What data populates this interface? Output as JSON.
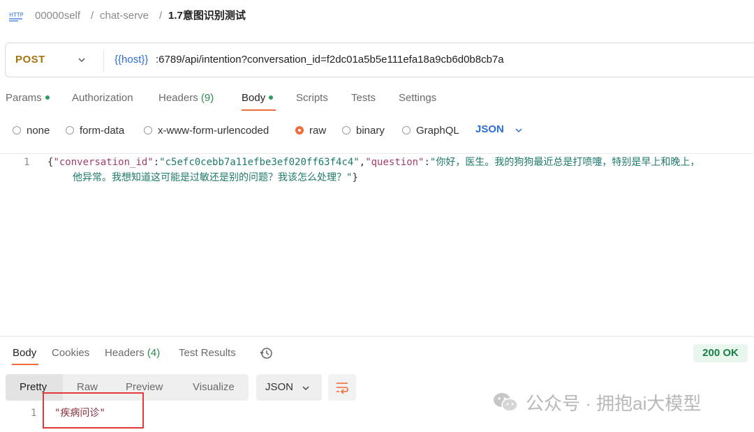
{
  "breadcrumb": {
    "icon_text": "HTTP",
    "workspace": "00000self",
    "collection": "chat-serve",
    "request": "1.7意图识别测试",
    "separator": "/"
  },
  "request": {
    "method": "POST",
    "url_variable": "{{host}}",
    "url_rest": ":6789/api/intention?conversation_id=f2dc01a5b5e111efa18a9cb6d0b8cb7a"
  },
  "request_tabs": {
    "params": "Params",
    "authorization": "Authorization",
    "headers": "Headers",
    "headers_count": "(9)",
    "body": "Body",
    "scripts": "Scripts",
    "tests": "Tests",
    "settings": "Settings"
  },
  "body_types": {
    "none": "none",
    "form_data": "form-data",
    "urlencoded": "x-www-form-urlencoded",
    "raw": "raw",
    "binary": "binary",
    "graphql": "GraphQL",
    "selected": "raw",
    "format": "JSON"
  },
  "editor": {
    "line_number": "1",
    "open_brace": "{",
    "key1": "\"conversation_id\"",
    "colon1": ":",
    "val1": "\"c5efc0cebb7a11efbe3ef020ff63f4c4\"",
    "comma": ",",
    "key2": "\"question\"",
    "colon2": ":",
    "val2_part1": "\"你好，医生。我的狗狗最近总是打喷嚏，特别是早上和晚上，",
    "val2_part2": "他异常。我想知道这可能是过敏还是别的问题？我该怎么处理？\"",
    "close_brace": "}"
  },
  "response_tabs": {
    "body": "Body",
    "cookies": "Cookies",
    "headers": "Headers",
    "headers_count": "(4)",
    "test_results": "Test Results"
  },
  "status": "200 OK",
  "view_modes": {
    "pretty": "Pretty",
    "raw": "Raw",
    "preview": "Preview",
    "visualize": "Visualize",
    "format": "JSON"
  },
  "response": {
    "line_number": "1",
    "value": "\"疾病问诊\""
  },
  "watermark": {
    "text": "公众号 · 拥抱ai大模型"
  },
  "colors": {
    "accent": "#f26b3a",
    "method": "#a9720c",
    "variable": "#2e6dd9",
    "status_ok": "#1a7f45",
    "highlight_box": "#e03a3a"
  }
}
